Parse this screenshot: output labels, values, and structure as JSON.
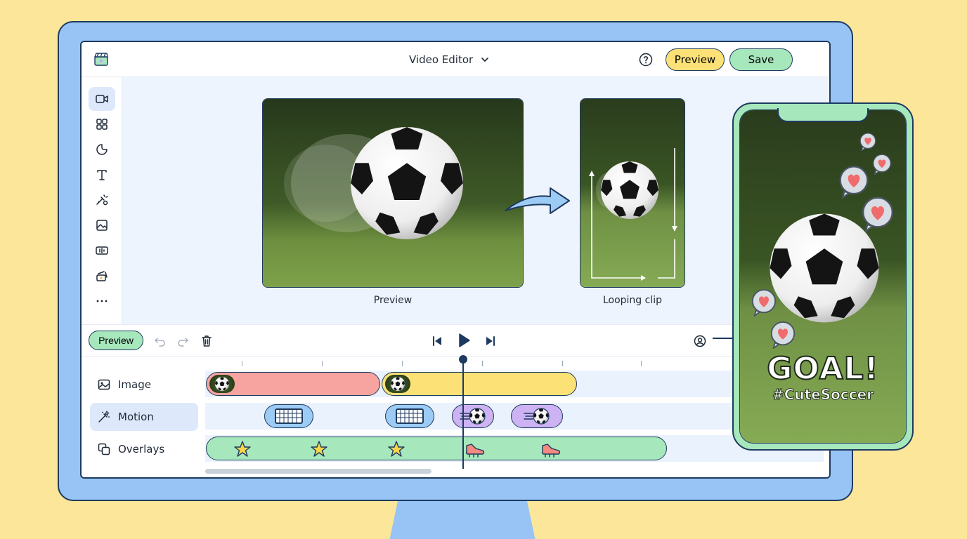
{
  "header": {
    "title": "Video Editor",
    "preview_label": "Preview",
    "save_label": "Save"
  },
  "rail": {
    "items": [
      {
        "icon": "video-icon",
        "active": true
      },
      {
        "icon": "grid-icon"
      },
      {
        "icon": "sticker-icon"
      },
      {
        "icon": "text-icon"
      },
      {
        "icon": "effects-icon"
      },
      {
        "icon": "image-icon"
      },
      {
        "icon": "audio-icon"
      },
      {
        "icon": "transition-icon"
      },
      {
        "icon": "more-icon"
      }
    ]
  },
  "canvas": {
    "main_caption": "Preview",
    "loop_caption": "Looping clip"
  },
  "playback": {
    "preview_label": "Preview"
  },
  "timeline": {
    "tracks": [
      {
        "label": "Image",
        "icon": "image-icon"
      },
      {
        "label": "Motion",
        "icon": "magic-wand-icon",
        "selected": true
      },
      {
        "label": "Overlays",
        "icon": "layers-icon"
      }
    ]
  },
  "phone": {
    "headline": "GOAL!",
    "hashtag": "#CuteSoccer"
  },
  "colors": {
    "background": "#fbe69a",
    "monitor": "#97c4f5",
    "outline": "#1e3a5f",
    "preview_button": "#fbe176",
    "save_button": "#a6e7bc",
    "image_clip_1": "#f7a3a0",
    "image_clip_2": "#fbe176",
    "motion_goal_chip": "#9ccbf5",
    "motion_ball_chip": "#cdb3f3",
    "overlay_clip": "#a6e7bc"
  }
}
